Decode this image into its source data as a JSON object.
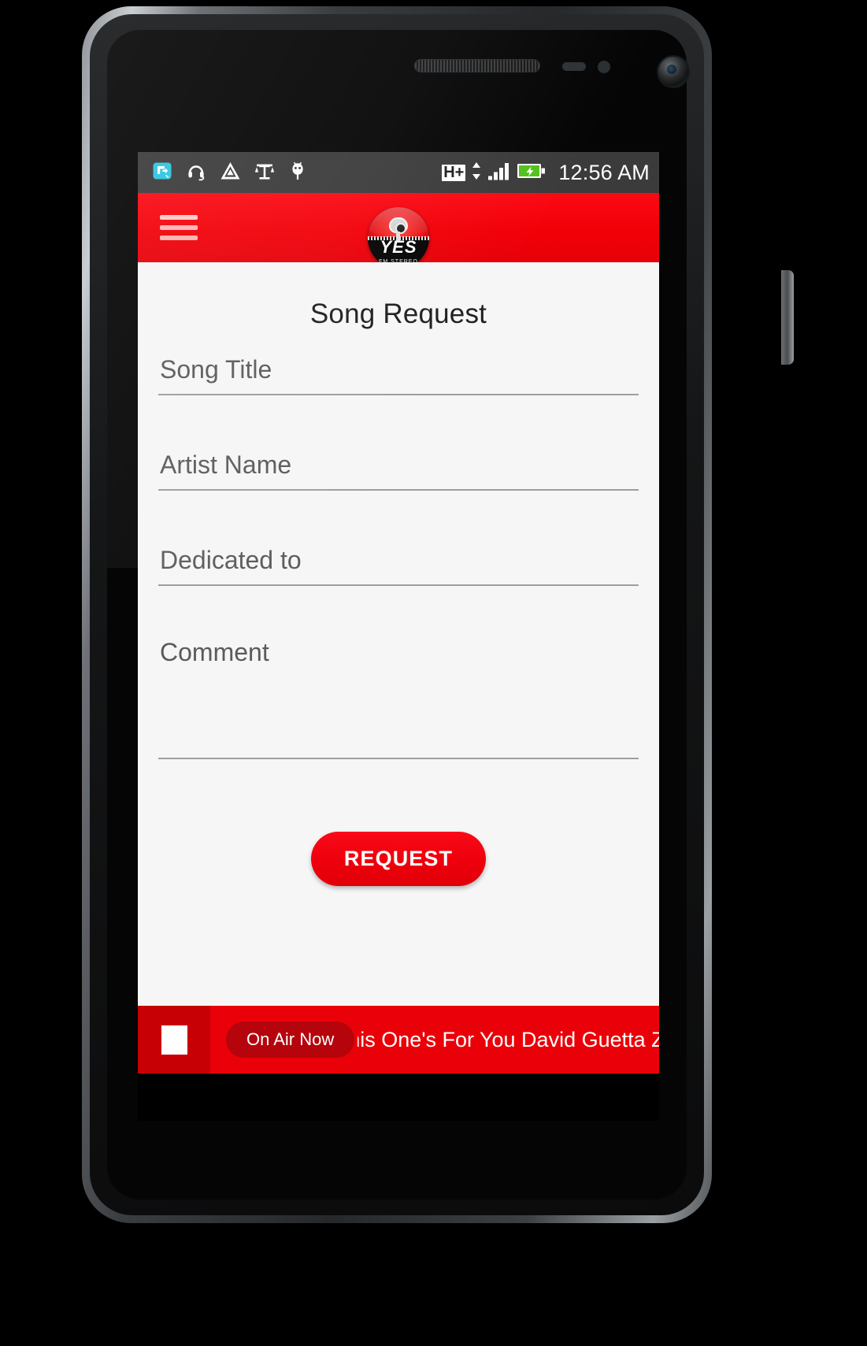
{
  "status_bar": {
    "time": "12:56 AM",
    "network_type": "H+",
    "left_icons": [
      "screen-cast-icon",
      "headset-icon",
      "triangle-warning-icon",
      "balance-scale-icon",
      "android-bug-icon"
    ],
    "right_icons": [
      "data-transfer-arrows-icon",
      "signal-bars-icon",
      "battery-charging-icon"
    ]
  },
  "app_bar": {
    "menu_label": "menu",
    "logo": {
      "name": "YES",
      "subtitle": "FM STEREO"
    }
  },
  "page": {
    "title": "Song Request"
  },
  "form": {
    "fields": [
      {
        "name": "song-title",
        "placeholder": "Song Title",
        "value": ""
      },
      {
        "name": "artist-name",
        "placeholder": "Artist Name",
        "value": ""
      },
      {
        "name": "dedicated-to",
        "placeholder": "Dedicated to",
        "value": ""
      },
      {
        "name": "comment",
        "placeholder": "Comment",
        "value": ""
      }
    ],
    "submit_label": "REQUEST"
  },
  "player": {
    "stop_icon": "stop-square-icon",
    "on_air_label": "On Air Now",
    "now_playing": "his One's For You David Guetta Zara Lars"
  },
  "colors": {
    "brand_red": "#ef000d",
    "app_bar_red": "#f20008",
    "player_red": "#ea0008",
    "stop_red": "#c70006",
    "badge_red": "#b5040c",
    "screen_bg": "#f6f6f6",
    "status_bar_bg": "#3b3b3b",
    "underline": "#9e9e9e",
    "placeholder": "#5b5b5b"
  }
}
